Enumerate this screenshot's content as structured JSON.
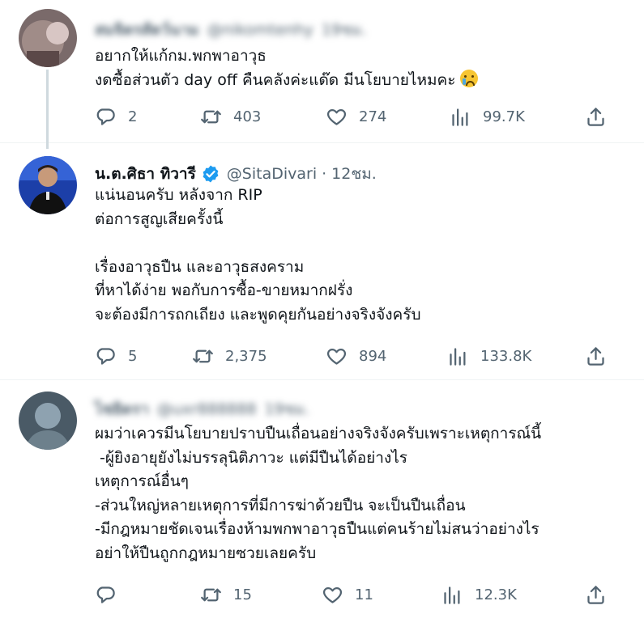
{
  "tweets": [
    {
      "author_name": "สมจิตรสัตว์นาม",
      "handle": "@nikomtenhy",
      "time": "19ชม.",
      "lines": [
        "อยากให้แก้กม.พกพาอาวุธ",
        "งดซื้อส่วนตัว day off คืนคลังค่ะแด๊ด มีนโยบายไหมคะ"
      ],
      "replies": "2",
      "retweets": "403",
      "likes": "274",
      "views": "99.7K"
    },
    {
      "author_name": "น.ต.ศิธา ทิวารี",
      "handle": "@SitaDivari",
      "separator": "·",
      "time": "12ชม.",
      "lines": [
        "แน่นอนครับ หลังจาก RIP",
        "ต่อการสูญเสียครั้งนี้",
        "",
        "เรื่องอาวุธปืน และอาวุธสงคราม",
        "ที่หาได้ง่าย พอกับการซื้อ-ขายหมากฝรั่ง",
        "จะต้องมีการถกเถียง และพูดคุยกันอย่างจริงจังครับ"
      ],
      "replies": "5",
      "retweets": "2,375",
      "likes": "894",
      "views": "133.8K"
    },
    {
      "author_name": "ไชยิดรา",
      "handle": "@uxr888888",
      "time": "19ชม.",
      "lines": [
        "ผมว่าเควรมีนโยบายปราบปืนเถื่อนอย่างจริงจังครับเพราะเหตุการณ์นี้",
        " -ผู้ยิงอายุยังไม่บรรลุนิติภาวะ แต่มีปืนได้อย่างไร",
        "เหตุการณ์อื่นๆ",
        "-ส่วนใหญ่หลายเหตุการที่มีการฆ่าด้วยปืน จะเป็นปืนเถื่อน",
        "-มีกฎหมายชัดเจนเรื่องห้ามพกพาอาวุธปืนแต่คนร้ายไม่สนว่าอย่างไร",
        "อย่าให้ปืนถูกกฎหมายซวยเลยครับ"
      ],
      "replies": "",
      "retweets": "15",
      "likes": "11",
      "views": "12.3K"
    }
  ],
  "icons": {
    "reply": "reply-icon",
    "retweet": "retweet-icon",
    "like": "heart-icon",
    "views": "views-icon",
    "share": "share-icon",
    "verified": "verified-badge-icon",
    "emoji": "crying-face-emoji"
  },
  "colors": {
    "verified": "#1d9bf0",
    "muted": "#536471",
    "thread_line": "#cfd9de"
  }
}
